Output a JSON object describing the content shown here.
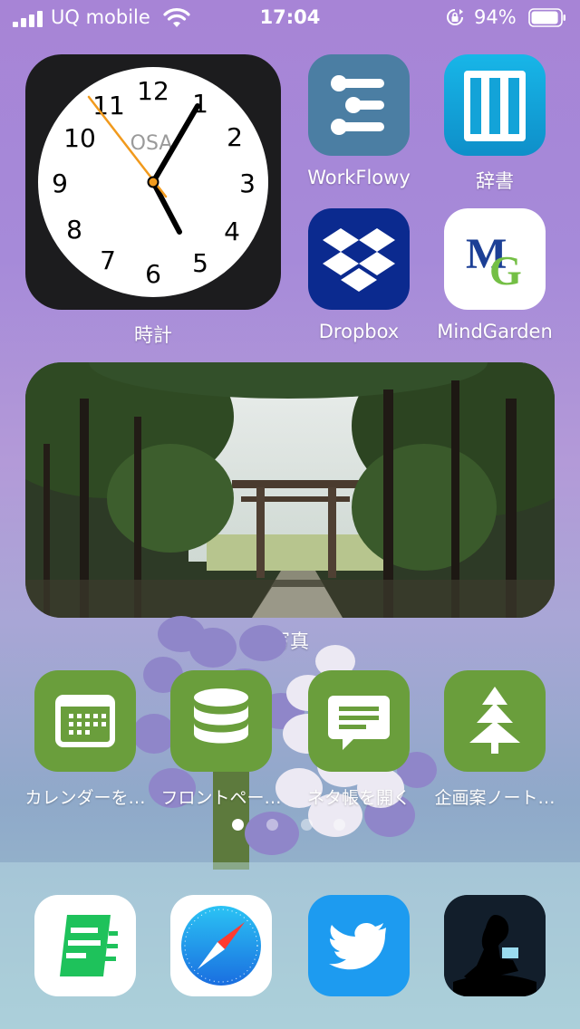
{
  "status_bar": {
    "carrier": "UQ mobile",
    "time": "17:04",
    "battery_percent": "94%",
    "battery_level": 0.94
  },
  "widgets": {
    "clock": {
      "label": "時計",
      "city": "OSA",
      "numbers": [
        "12",
        "1",
        "2",
        "3",
        "4",
        "5",
        "6",
        "7",
        "8",
        "9",
        "10",
        "11"
      ],
      "time_shown": "5:04:51"
    },
    "photos": {
      "label": "写真"
    }
  },
  "apps": {
    "row1": [
      {
        "label": "WorkFlowy",
        "icon": "workflowy-icon"
      },
      {
        "label": "辞書",
        "icon": "dictionary-icon"
      }
    ],
    "row2": [
      {
        "label": "Dropbox",
        "icon": "dropbox-icon"
      },
      {
        "label": "MindGarden",
        "icon": "mindgarden-icon"
      }
    ],
    "shortcuts": [
      {
        "label": "カレンダーを…",
        "icon": "calendar-icon"
      },
      {
        "label": "フロントペー…",
        "icon": "database-icon"
      },
      {
        "label": "ネタ帳を開く",
        "icon": "message-icon"
      },
      {
        "label": "企画案ノート…",
        "icon": "tree-icon"
      }
    ]
  },
  "page_dots": {
    "count": 4,
    "active": 0
  },
  "dock": [
    {
      "icon": "notes-app-icon"
    },
    {
      "icon": "safari-icon"
    },
    {
      "icon": "twitter-icon"
    },
    {
      "icon": "kindle-icon"
    }
  ],
  "colors": {
    "shortcut_green": "#6a9e3c",
    "workflowy_bg": "#4b7ea3",
    "dictionary_bg": "#13a3d8",
    "dropbox_bg": "#0b2a8f",
    "twitter_bg": "#1d9bf0"
  }
}
